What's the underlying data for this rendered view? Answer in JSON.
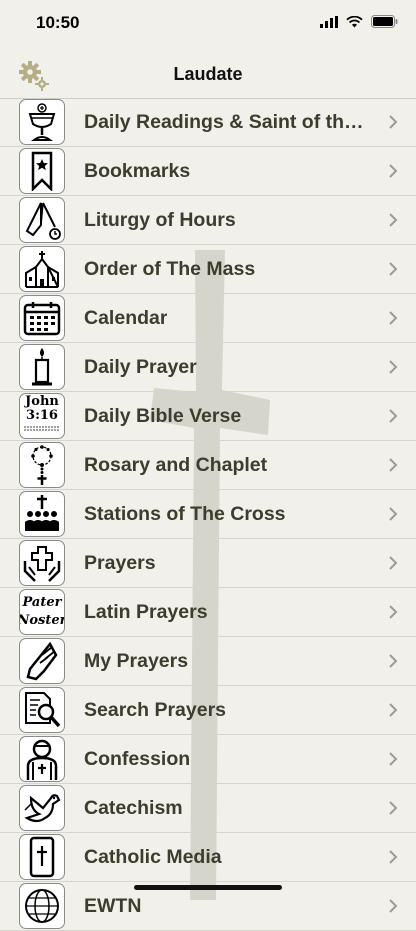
{
  "status": {
    "time": "10:50"
  },
  "nav": {
    "title": "Laudate"
  },
  "menu": [
    {
      "label": "Daily Readings & Saint of the Day",
      "icon": "chalice-icon"
    },
    {
      "label": "Bookmarks",
      "icon": "bookmark-icon"
    },
    {
      "label": "Liturgy of Hours",
      "icon": "praying-hands-clock-icon"
    },
    {
      "label": "Order of The Mass",
      "icon": "church-icon"
    },
    {
      "label": "Calendar",
      "icon": "calendar-icon"
    },
    {
      "label": "Daily Prayer",
      "icon": "candle-icon"
    },
    {
      "label": "Daily Bible Verse",
      "icon": "bible-verse-icon",
      "icon_text": [
        "John",
        "3:16"
      ]
    },
    {
      "label": "Rosary and Chaplet",
      "icon": "rosary-icon"
    },
    {
      "label": "Stations of The Cross",
      "icon": "stations-icon"
    },
    {
      "label": "Prayers",
      "icon": "hands-cross-icon"
    },
    {
      "label": "Latin Prayers",
      "icon": "pater-noster-icon",
      "icon_text": [
        "Pater",
        "Noster"
      ]
    },
    {
      "label": "My Prayers",
      "icon": "praying-hands-icon"
    },
    {
      "label": "Search Prayers",
      "icon": "search-document-icon"
    },
    {
      "label": "Confession",
      "icon": "priest-icon"
    },
    {
      "label": "Catechism",
      "icon": "dove-icon"
    },
    {
      "label": "Catholic Media",
      "icon": "phone-cross-icon"
    },
    {
      "label": "EWTN",
      "icon": "globe-icon"
    }
  ]
}
